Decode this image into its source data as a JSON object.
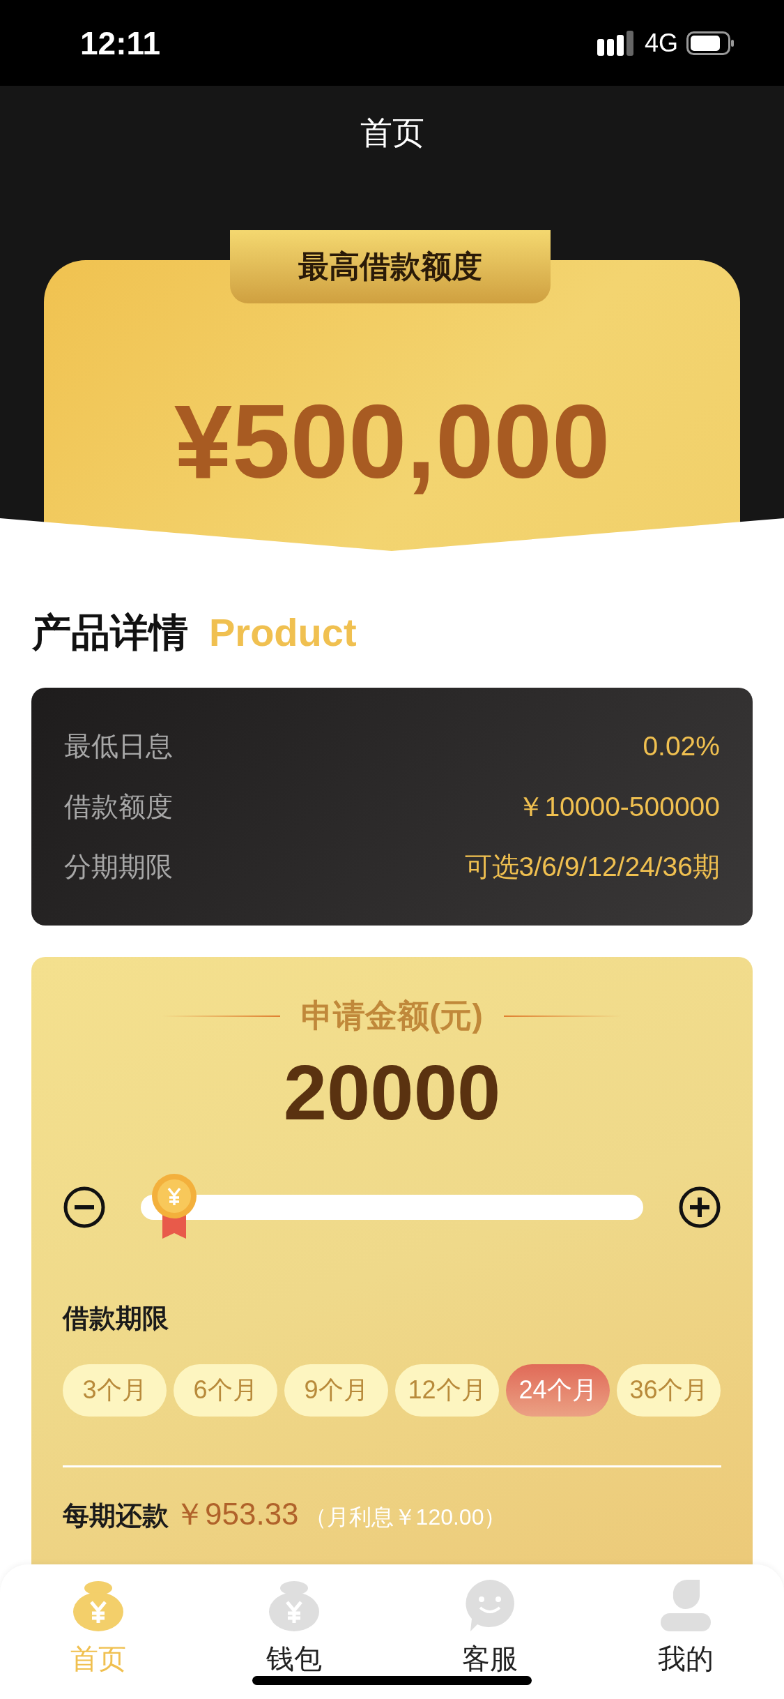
{
  "status_bar": {
    "time": "12:11",
    "network": "4G"
  },
  "nav": {
    "title": "首页"
  },
  "hero": {
    "badge": "最高借款额度",
    "amount": "¥500,000"
  },
  "section": {
    "title": "产品详情",
    "subtitle": "Product"
  },
  "details": [
    {
      "label": "最低日息",
      "value": "0.02%"
    },
    {
      "label": "借款额度",
      "value": "￥10000-500000"
    },
    {
      "label": "分期期限",
      "value": "可选3/6/9/12/24/36期"
    }
  ],
  "apply": {
    "title": "申请金额(元)",
    "amount": "20000",
    "slider": {
      "level": 0.02
    },
    "term_label": "借款期限",
    "terms": [
      {
        "label": "3个月",
        "selected": false
      },
      {
        "label": "6个月",
        "selected": false
      },
      {
        "label": "9个月",
        "selected": false
      },
      {
        "label": "12个月",
        "selected": false
      },
      {
        "label": "24个月",
        "selected": true
      },
      {
        "label": "36个月",
        "selected": false
      }
    ],
    "repayment": {
      "label": "每期还款",
      "amount": "￥953.33",
      "note": "（月利息￥120.00）"
    }
  },
  "tabs": [
    {
      "label": "首页",
      "kind": "bag",
      "selected": true
    },
    {
      "label": "钱包",
      "kind": "bag",
      "selected": false
    },
    {
      "label": "客服",
      "kind": "chat",
      "selected": false
    },
    {
      "label": "我的",
      "kind": "person",
      "selected": false
    }
  ]
}
